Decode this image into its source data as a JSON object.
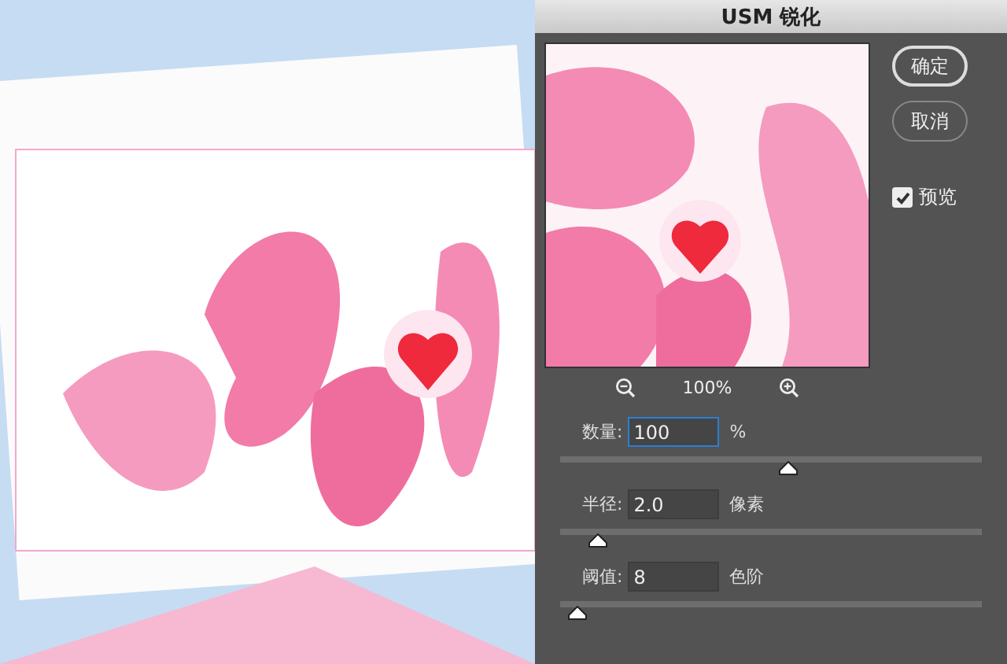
{
  "dialog": {
    "title": "USM 锐化",
    "buttons": [
      {
        "label": "确定",
        "default": true
      },
      {
        "label": "取消",
        "default": false
      }
    ],
    "preview_option": {
      "label": "预览",
      "checked": true
    },
    "zoom": {
      "level_text": "100%"
    },
    "params": [
      {
        "label": "数量:",
        "value": "100",
        "unit": "%",
        "focused": true,
        "level": 0.54
      },
      {
        "label": "半径:",
        "value": "2.0",
        "unit": "像素",
        "focused": false,
        "level": 0.09
      },
      {
        "label": "阈值:",
        "value": "8",
        "unit": "色阶",
        "focused": false,
        "level": 0.04
      }
    ]
  }
}
